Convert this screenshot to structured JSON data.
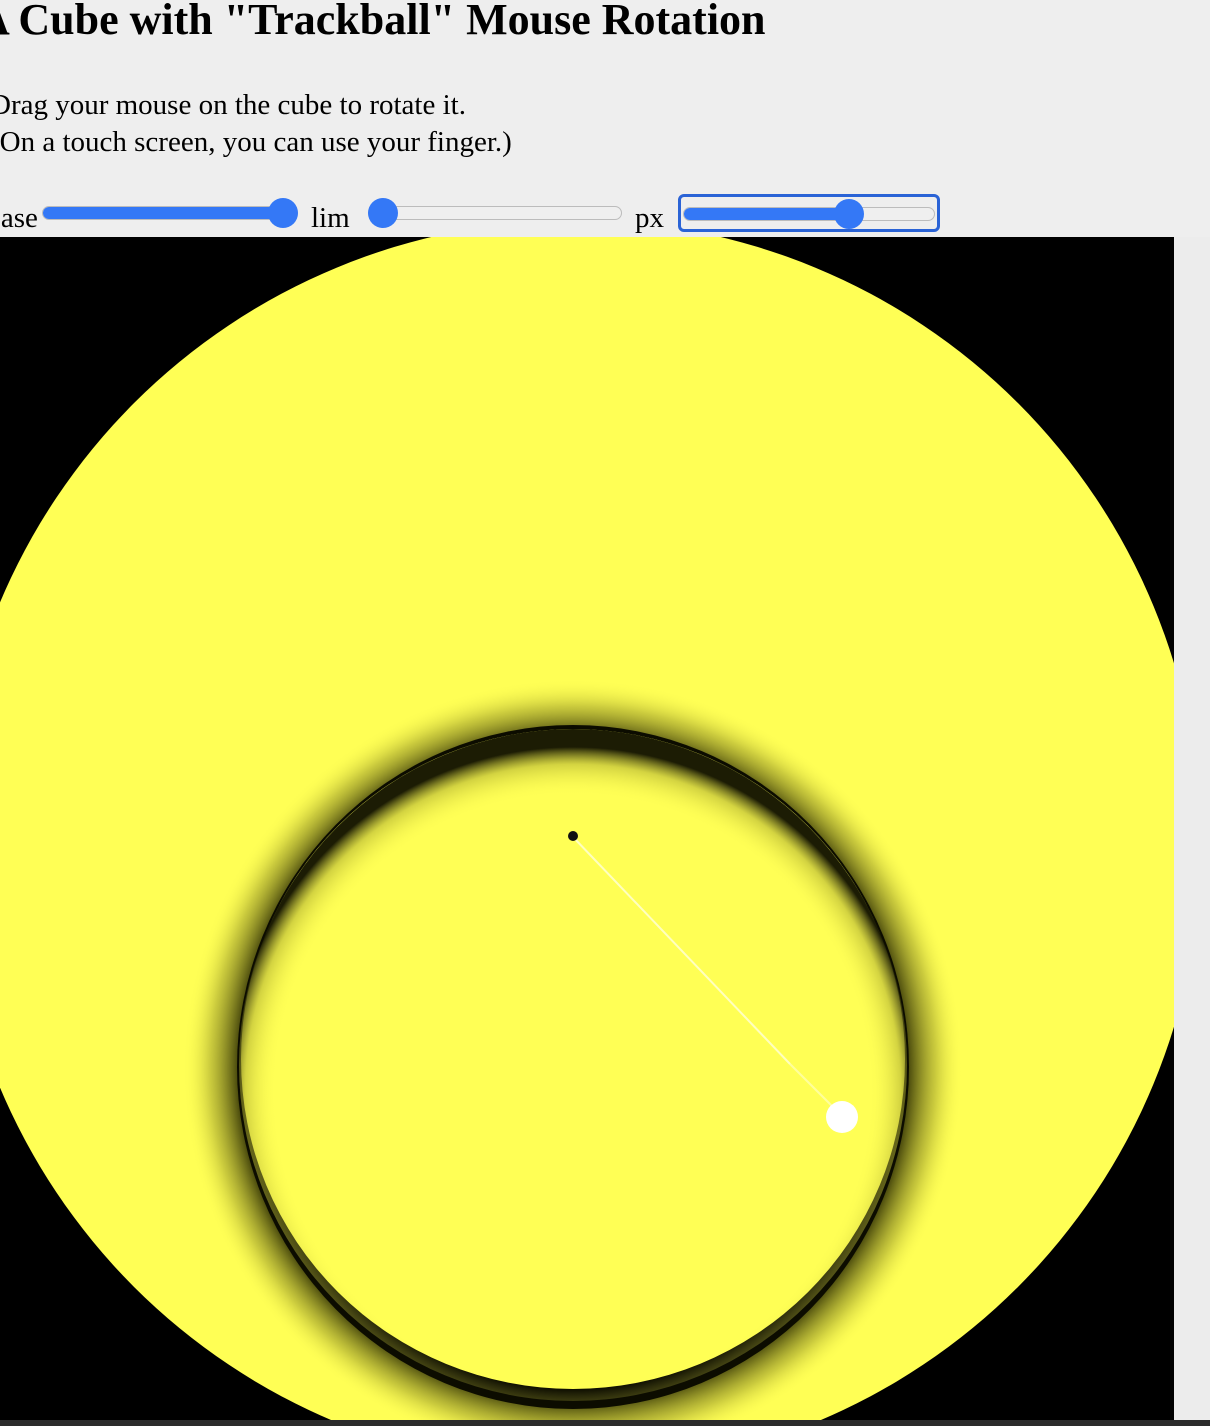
{
  "page": {
    "title": "A Cube with \"Trackball\" Mouse Rotation",
    "instructions": [
      "Drag your mouse on the cube to rotate it.",
      "(On a touch screen, you can use your finger.)"
    ]
  },
  "controls": {
    "ease": {
      "label": "ease",
      "value_fraction": 1.0
    },
    "lim": {
      "label": "lim",
      "value_fraction": 0.0
    },
    "px": {
      "label": "px",
      "value_fraction": 0.68,
      "focused": true
    }
  },
  "scene": {
    "background_color": "#000000",
    "object_color": "#ffff55",
    "handle_color": "#ffffff"
  }
}
